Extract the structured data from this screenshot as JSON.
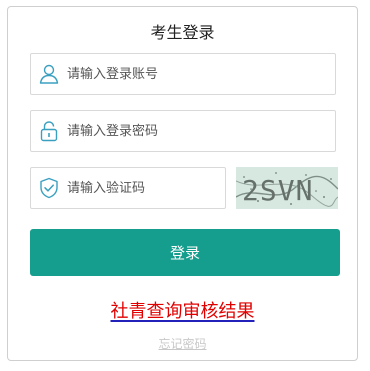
{
  "login": {
    "title": "考生登录",
    "account_placeholder": "请输入登录账号",
    "password_placeholder": "请输入登录密码",
    "captcha_placeholder": "请输入验证码",
    "captcha_text": "2SVN",
    "submit_label": "登录",
    "query_link": "社青查询审核结果",
    "forgot_link": "忘记密码"
  },
  "colors": {
    "accent": "#159d8d",
    "link_red": "#e00000",
    "icon": "#3aa0c0"
  },
  "icons": {
    "account": "user-icon",
    "password": "lock-icon",
    "captcha": "shield-check-icon"
  }
}
